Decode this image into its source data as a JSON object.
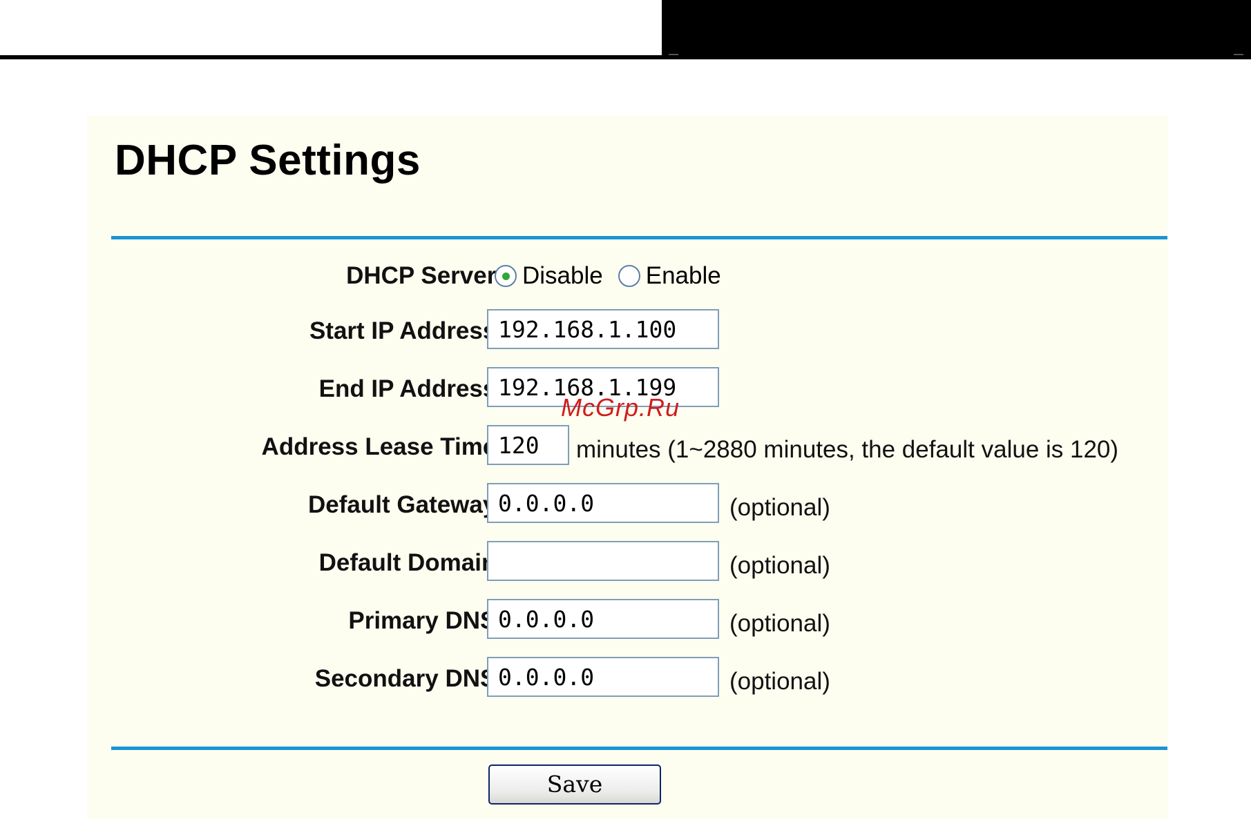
{
  "page": {
    "title": "DHCP Settings"
  },
  "dhcp_server": {
    "label": "DHCP Server:",
    "options": [
      {
        "label": "Disable",
        "selected": true
      },
      {
        "label": "Enable",
        "selected": false
      }
    ]
  },
  "fields": {
    "start_ip": {
      "label": "Start IP Address:",
      "value": "192.168.1.100"
    },
    "end_ip": {
      "label": "End IP Address:",
      "value": "192.168.1.199"
    },
    "lease_time": {
      "label": "Address Lease Time:",
      "value": "120",
      "hint": "minutes (1~2880 minutes, the default value is 120)"
    },
    "default_gateway": {
      "label": "Default Gateway:",
      "value": "0.0.0.0",
      "hint": "(optional)"
    },
    "default_domain": {
      "label": "Default Domain:",
      "value": "",
      "hint": "(optional)"
    },
    "primary_dns": {
      "label": "Primary DNS:",
      "value": "0.0.0.0",
      "hint": "(optional)"
    },
    "secondary_dns": {
      "label": "Secondary DNS:",
      "value": "0.0.0.0",
      "hint": "(optional)"
    }
  },
  "actions": {
    "save_label": "Save"
  },
  "watermark": "McGrp.Ru",
  "colors": {
    "panel_background": "#fdfdf0",
    "rule_accent": "#1a94d3",
    "radio_selected": "#2fa83a",
    "watermark": "#d01c1c"
  }
}
